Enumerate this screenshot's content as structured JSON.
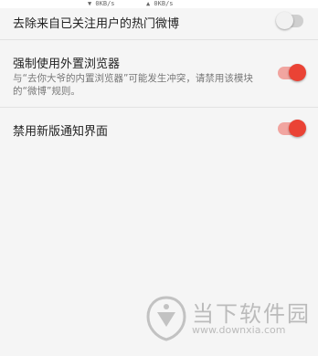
{
  "status_bar": {
    "download_speed": "▼ 0KB/s",
    "upload_speed": "▲ 0KB/s"
  },
  "settings": [
    {
      "title": "去除来自已关注用户的热门微博",
      "summary": "",
      "enabled": false
    },
    {
      "title": "强制使用外置浏览器",
      "summary": "与“去你大爷的内置浏览器”可能发生冲突，请禁用该模块的“微博”规则。",
      "enabled": true
    },
    {
      "title": "禁用新版通知界面",
      "summary": "",
      "enabled": true
    }
  ],
  "watermark": {
    "name": "当下软件园",
    "url": "www.downxia.com"
  },
  "colors": {
    "accent": "#ea4335",
    "background": "#f5f5f5",
    "divider": "#e2e2e2"
  }
}
